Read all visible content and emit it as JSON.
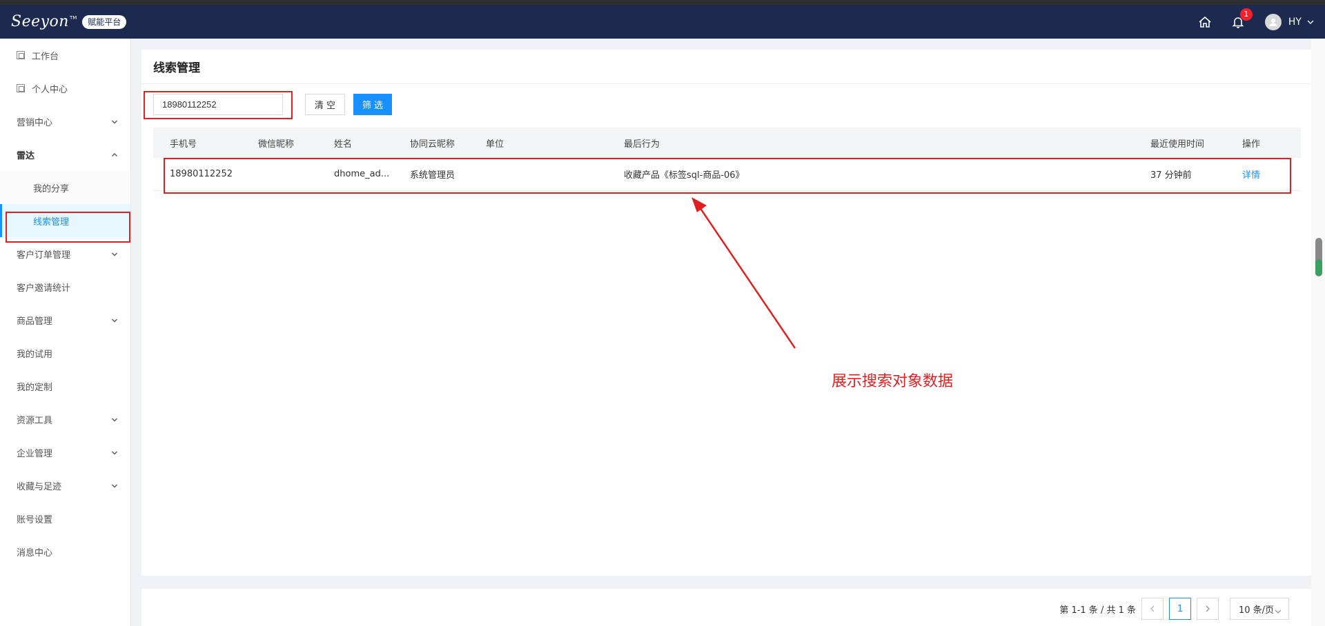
{
  "header": {
    "logo": "Seeyon",
    "logo_badge": "赋能平台",
    "notification_count": "1",
    "user": "HY"
  },
  "sidebar": {
    "items": [
      {
        "label": "工作台"
      },
      {
        "label": "个人中心"
      },
      {
        "label": "营销中心"
      },
      {
        "label": "雷达"
      },
      {
        "label": "我的分享"
      },
      {
        "label": "线索管理"
      },
      {
        "label": "客户订单管理"
      },
      {
        "label": "客户邀请统计"
      },
      {
        "label": "商品管理"
      },
      {
        "label": "我的试用"
      },
      {
        "label": "我的定制"
      },
      {
        "label": "资源工具"
      },
      {
        "label": "企业管理"
      },
      {
        "label": "收藏与足迹"
      },
      {
        "label": "账号设置"
      },
      {
        "label": "消息中心"
      }
    ]
  },
  "page": {
    "title": "线索管理",
    "search_value": "18980112252",
    "clear_label": "清 空",
    "filter_label": "筛 选"
  },
  "table": {
    "headers": [
      "手机号",
      "微信昵称",
      "姓名",
      "协同云昵称",
      "单位",
      "最后行为",
      "最近使用时间",
      "操作"
    ],
    "rows": [
      {
        "phone": "18980112252",
        "wechat": "",
        "name": "dhome_ad...",
        "nickname": "系统管理员",
        "unit": "",
        "last_action": "收藏产品《标签sql-商品-06》",
        "last_used": "37 分钟前",
        "action": "详情"
      }
    ]
  },
  "annotation": {
    "text": "展示搜索对象数据",
    "color": "#e02020"
  },
  "pagination": {
    "summary": "第 1-1 条 / 共 1 条",
    "current": "1",
    "page_size": "10 条/页"
  }
}
